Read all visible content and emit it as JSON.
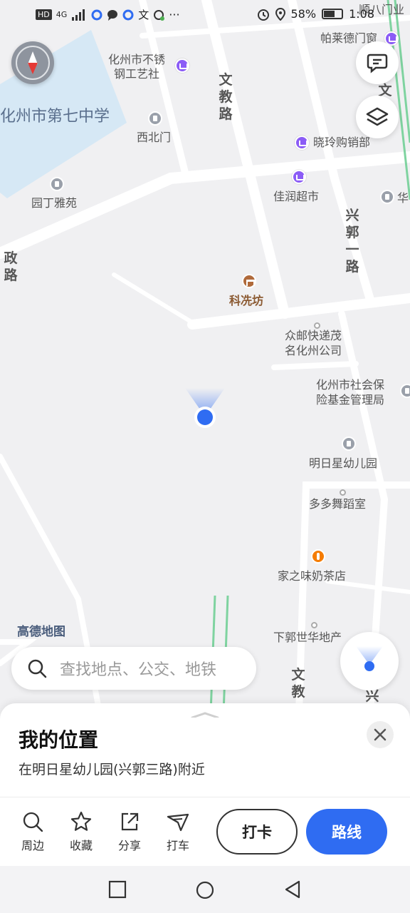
{
  "status_bar": {
    "left_badge": "HD",
    "network": "4G",
    "battery": "58%",
    "time": "1:08"
  },
  "map": {
    "logo": "高德地图",
    "area_labels": {
      "school": "化州市第七中学"
    },
    "roads": {
      "wenjiao_top": "文教路",
      "wenjiao_bottom": "文教",
      "xingguo_1": "兴郭一路",
      "left_road": "政路",
      "xing_bottom": "兴",
      "wenjiao_partial_right": "文"
    },
    "pois": [
      {
        "label": "化州市不锈\n钢工艺社",
        "icon": "shop-icon"
      },
      {
        "label": "西北门",
        "icon": "gate-icon"
      },
      {
        "label": "园丁雅苑",
        "icon": "residence-icon"
      },
      {
        "label": "晓玲购销部",
        "icon": "shop-icon"
      },
      {
        "label": "佳润超市",
        "icon": "shop-icon"
      },
      {
        "label": "科冼坊",
        "icon": "landmark-icon"
      },
      {
        "label": "众邮快递茂\n名化州公司",
        "icon": "dot-icon"
      },
      {
        "label": "化州市社会保\n险基金管理局",
        "icon": "government-icon"
      },
      {
        "label": "明日星幼儿园",
        "icon": "school-icon"
      },
      {
        "label": "多多舞蹈室",
        "icon": "dot-icon"
      },
      {
        "label": "家之味奶茶店",
        "icon": "food-icon"
      },
      {
        "label": "下郭世华地产",
        "icon": "dot-icon"
      },
      {
        "label": "帕莱德门窗",
        "icon": "shop-icon"
      },
      {
        "label": "顺八门业",
        "icon": "shop-icon"
      },
      {
        "label": "华",
        "icon": "tag-icon"
      }
    ]
  },
  "search": {
    "placeholder": "查找地点、公交、地铁"
  },
  "sheet": {
    "title": "我的位置",
    "subtitle": "在明日星幼儿园(兴郭三路)附近",
    "actions": [
      {
        "label": "周边",
        "icon": "search-icon"
      },
      {
        "label": "收藏",
        "icon": "star-icon"
      },
      {
        "label": "分享",
        "icon": "share-icon"
      },
      {
        "label": "打车",
        "icon": "taxi-icon"
      }
    ],
    "checkin_label": "打卡",
    "route_label": "路线"
  },
  "colors": {
    "accent": "#2f6cf2",
    "school_area": "#d6e8f5",
    "metro_line": "#7fd3a0",
    "location": "#2f6cf2"
  }
}
